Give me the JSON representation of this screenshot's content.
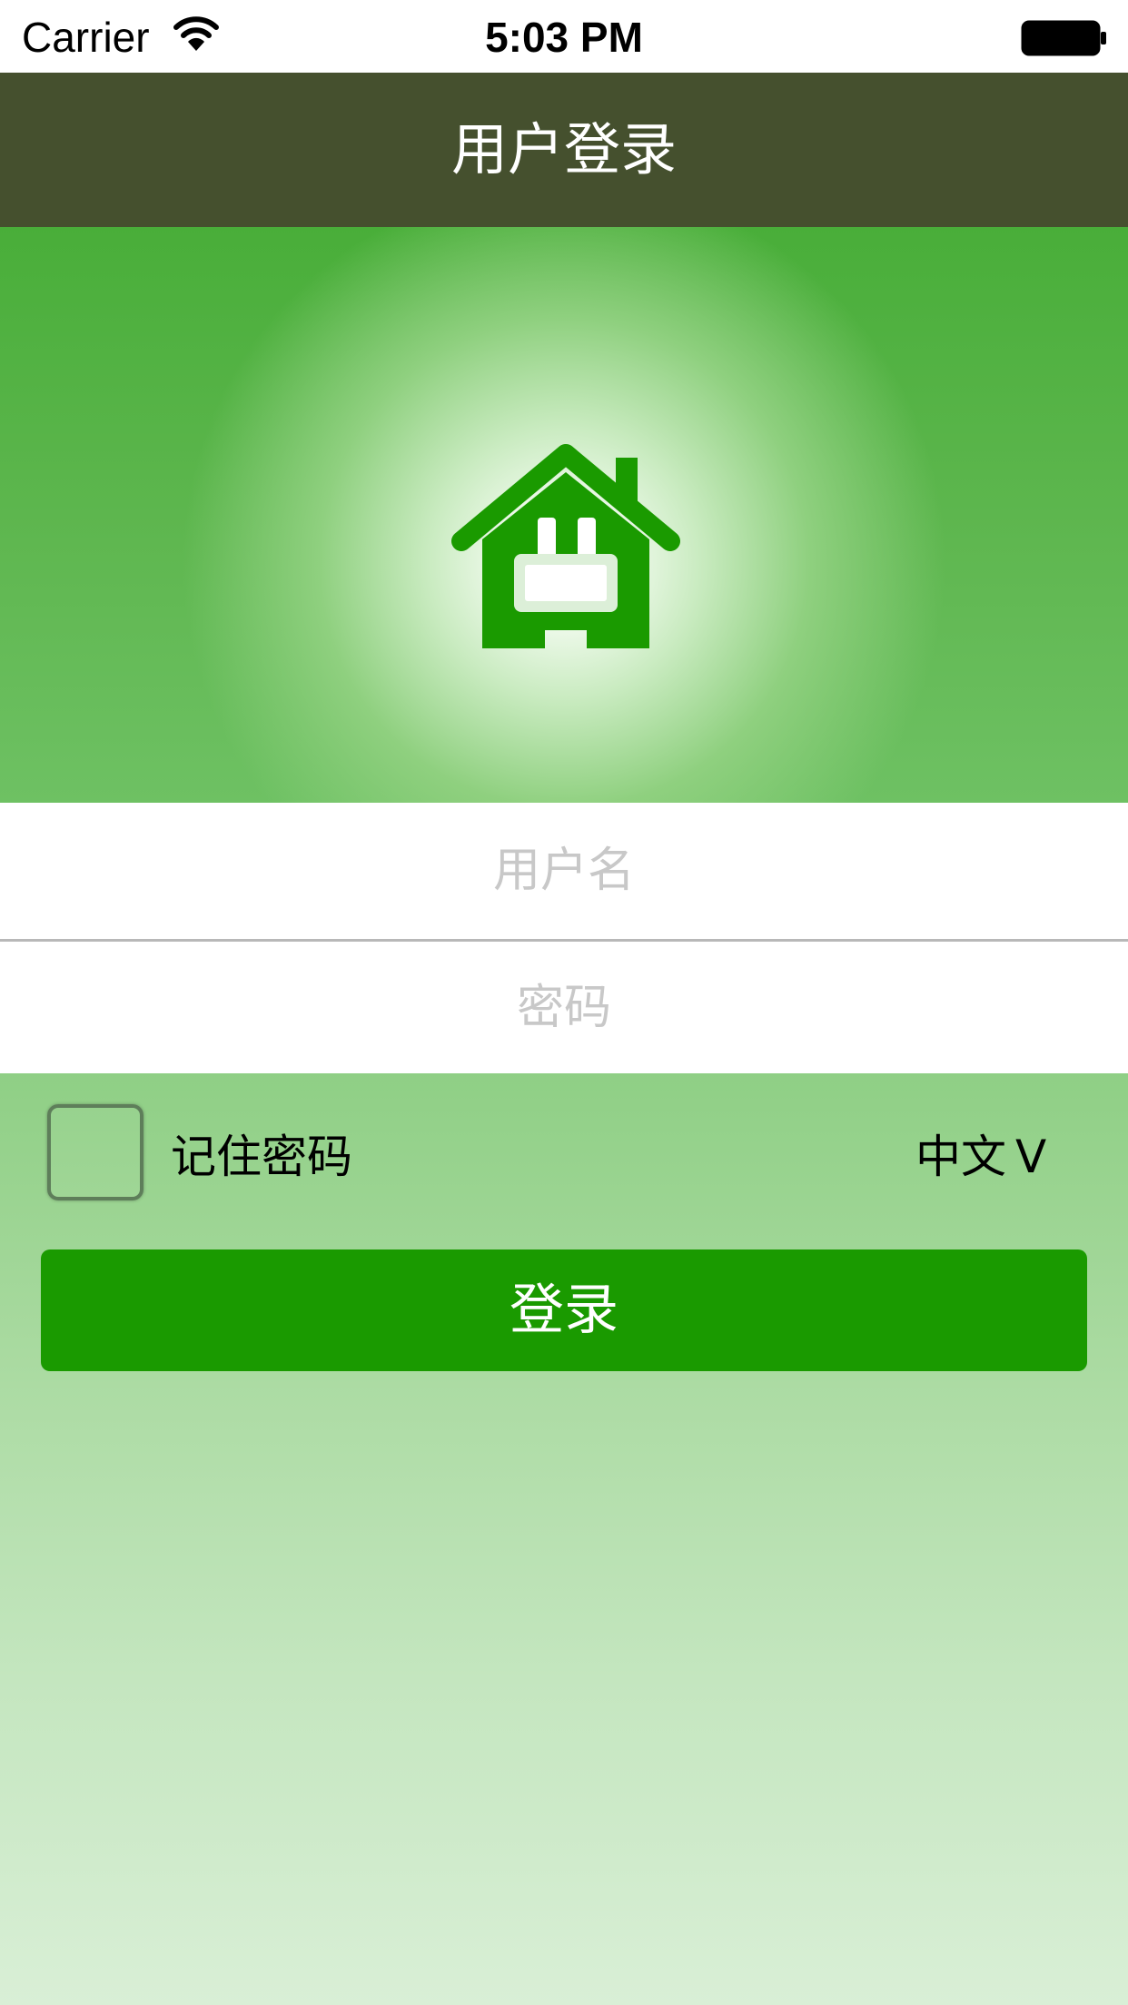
{
  "status_bar": {
    "carrier": "Carrier",
    "time": "5:03 PM"
  },
  "nav": {
    "title": "用户登录"
  },
  "hero": {
    "logo_icon": "house-logo-icon"
  },
  "form": {
    "username_placeholder": "用户名",
    "password_placeholder": "密码"
  },
  "options": {
    "remember_label": "记住密码",
    "remember_checked": false,
    "language_label": "中文",
    "language_arrow": "V"
  },
  "login_button": {
    "label": "登录"
  },
  "colors": {
    "nav_bg": "#45502e",
    "accent_green": "#1a9a00",
    "hero_green": "#49ae39"
  }
}
